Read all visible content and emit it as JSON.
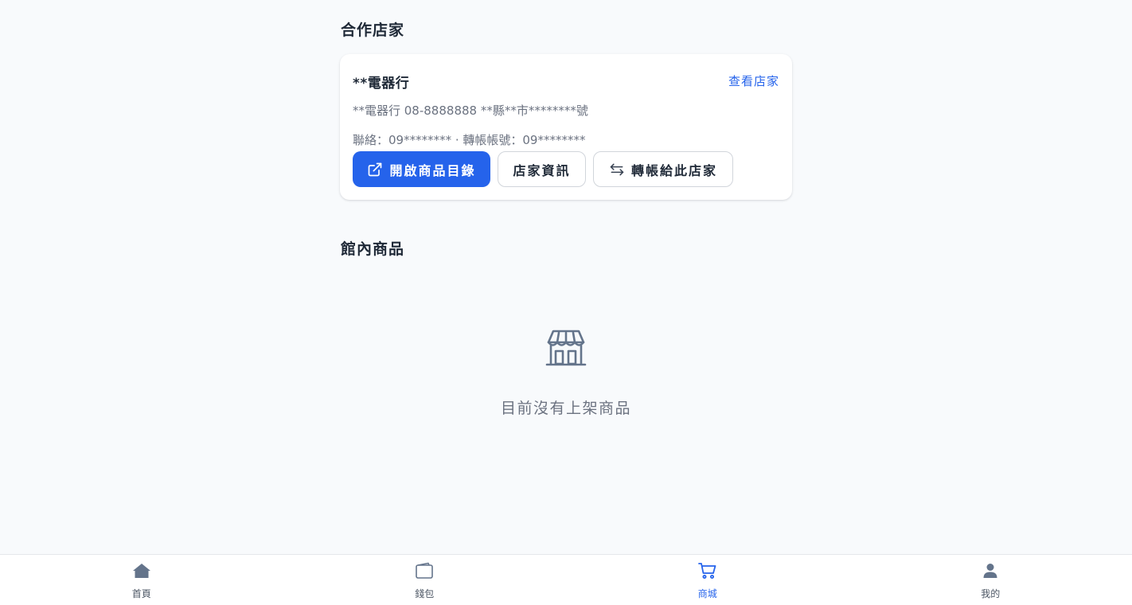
{
  "partners": {
    "title": "合作店家",
    "store": {
      "name": "**電器行",
      "view_label": "查看店家",
      "address_line": "**電器行 08-8888888 **縣**市********號",
      "contact_line": "聯絡：09******** · 轉帳帳號：09********",
      "buttons": {
        "open_catalog": "開啟商品目錄",
        "store_info": "店家資訊",
        "transfer": "轉帳給此店家"
      }
    }
  },
  "products": {
    "title": "館內商品",
    "empty_text": "目前沒有上架商品"
  },
  "nav": {
    "items": [
      {
        "label": "首頁",
        "icon": "home-icon"
      },
      {
        "label": "錢包",
        "icon": "wallet-icon"
      },
      {
        "label": "商城",
        "icon": "cart-icon",
        "active": true
      },
      {
        "label": "我的",
        "icon": "user-icon"
      }
    ]
  },
  "colors": {
    "accent": "#2563eb",
    "background": "#f8fafc",
    "muted_text": "#6b7280",
    "icon_gray": "#64748b"
  }
}
